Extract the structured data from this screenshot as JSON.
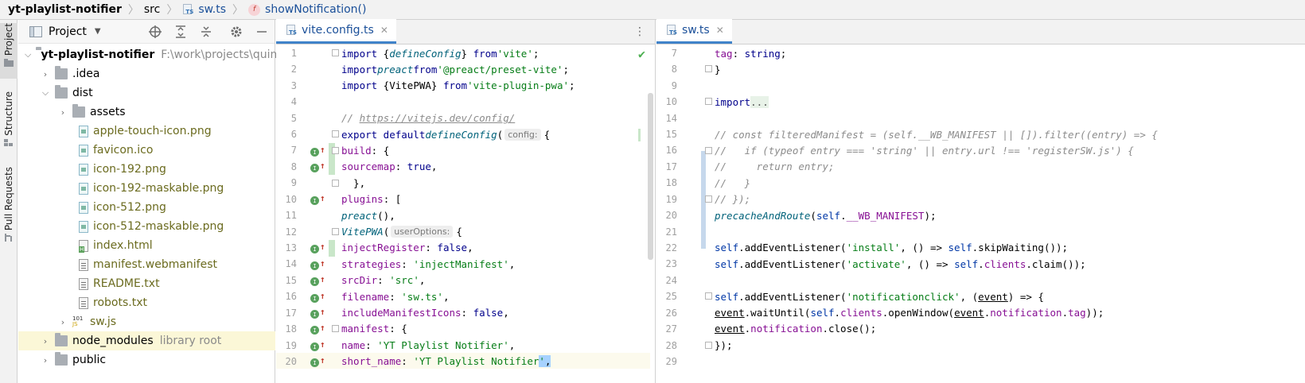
{
  "breadcrumb": {
    "project": "yt-playlist-notifier",
    "folder": "src",
    "file": "sw.ts",
    "function": "showNotification()"
  },
  "toolstrip": {
    "project_tab": "Project",
    "structure_tab": "Structure",
    "pull_requests_tab": "Pull Requests"
  },
  "project_panel": {
    "title": "Project",
    "root_name": "yt-playlist-notifier",
    "root_path": "F:\\work\\projects\\quini",
    "items": [
      {
        "label": "yt-playlist-notifier"
      },
      {
        "label": ".idea"
      },
      {
        "label": "dist"
      },
      {
        "label": "assets"
      },
      {
        "label": "apple-touch-icon.png"
      },
      {
        "label": "favicon.ico"
      },
      {
        "label": "icon-192.png"
      },
      {
        "label": "icon-192-maskable.png"
      },
      {
        "label": "icon-512.png"
      },
      {
        "label": "icon-512-maskable.png"
      },
      {
        "label": "index.html"
      },
      {
        "label": "manifest.webmanifest"
      },
      {
        "label": "README.txt"
      },
      {
        "label": "robots.txt"
      },
      {
        "label": "sw.js"
      },
      {
        "label": "node_modules"
      },
      {
        "label": "public"
      }
    ],
    "node_modules_hint": "library root",
    "js_badge": "101"
  },
  "left_editor": {
    "tab_label": "vite.config.ts",
    "tab_icon": "TS",
    "close": "✕",
    "menu": "⋮",
    "hint_config": "config:",
    "hint_useroptions": "userOptions:",
    "line_numbers": [
      "1",
      "2",
      "3",
      "4",
      "5",
      "6",
      "7",
      "8",
      "9",
      "10",
      "11",
      "12",
      "13",
      "14",
      "15",
      "16",
      "17",
      "18",
      "19",
      "20"
    ]
  },
  "right_editor": {
    "tab_label": "sw.ts",
    "tab_icon": "TS",
    "close": "✕",
    "line_numbers": [
      "7",
      "8",
      "9",
      "10",
      "14",
      "15",
      "16",
      "17",
      "18",
      "19",
      "20",
      "21",
      "22",
      "23",
      "24",
      "25",
      "26",
      "27",
      "28",
      "29"
    ]
  },
  "colors": {
    "accent": "#4083c9",
    "keyword": "#00008b",
    "string": "#067d17",
    "property": "#871094",
    "comment": "#8c8c8c"
  }
}
